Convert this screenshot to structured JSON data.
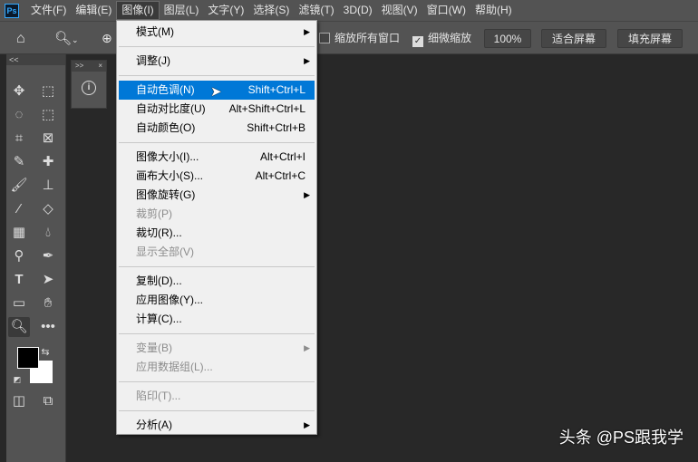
{
  "app": {
    "logo": "Ps"
  },
  "menubar": [
    "文件(F)",
    "编辑(E)",
    "图像(I)",
    "图层(L)",
    "文字(Y)",
    "选择(S)",
    "滤镜(T)",
    "3D(D)",
    "视图(V)",
    "窗口(W)",
    "帮助(H)"
  ],
  "options": {
    "zoom_all_windows": "缩放所有窗口",
    "scrubby_zoom": "细微缩放",
    "zoom_value": "100%",
    "fit_screen": "适合屏幕",
    "fill_screen": "填充屏幕",
    "zoom_all_checked": false,
    "scrubby_checked": true
  },
  "toolbox": {
    "collapse": "<<",
    "fg_color": "#000000",
    "bg_color": "#ffffff"
  },
  "panel": {
    "expand": ">>",
    "close": "×"
  },
  "menu": {
    "items": [
      {
        "label": "模式(M)",
        "submenu": true
      },
      {
        "sep": true
      },
      {
        "label": "调整(J)",
        "submenu": true
      },
      {
        "sep": true
      },
      {
        "label": "自动色调(N)",
        "shortcut": "Shift+Ctrl+L",
        "highlighted": true
      },
      {
        "label": "自动对比度(U)",
        "shortcut": "Alt+Shift+Ctrl+L"
      },
      {
        "label": "自动颜色(O)",
        "shortcut": "Shift+Ctrl+B"
      },
      {
        "sep": true
      },
      {
        "label": "图像大小(I)...",
        "shortcut": "Alt+Ctrl+I"
      },
      {
        "label": "画布大小(S)...",
        "shortcut": "Alt+Ctrl+C"
      },
      {
        "label": "图像旋转(G)",
        "submenu": true
      },
      {
        "label": "裁剪(P)",
        "disabled": true
      },
      {
        "label": "裁切(R)..."
      },
      {
        "label": "显示全部(V)",
        "disabled": true
      },
      {
        "sep": true
      },
      {
        "label": "复制(D)..."
      },
      {
        "label": "应用图像(Y)..."
      },
      {
        "label": "计算(C)..."
      },
      {
        "sep": true
      },
      {
        "label": "变量(B)",
        "submenu": true,
        "disabled": true
      },
      {
        "label": "应用数据组(L)...",
        "disabled": true
      },
      {
        "sep": true
      },
      {
        "label": "陷印(T)...",
        "disabled": true
      },
      {
        "sep": true
      },
      {
        "label": "分析(A)",
        "submenu": true
      }
    ]
  },
  "watermark": "头条 @PS跟我学",
  "colors": {
    "highlight": "#0078d7",
    "chrome": "#535353",
    "canvas": "#282828"
  }
}
